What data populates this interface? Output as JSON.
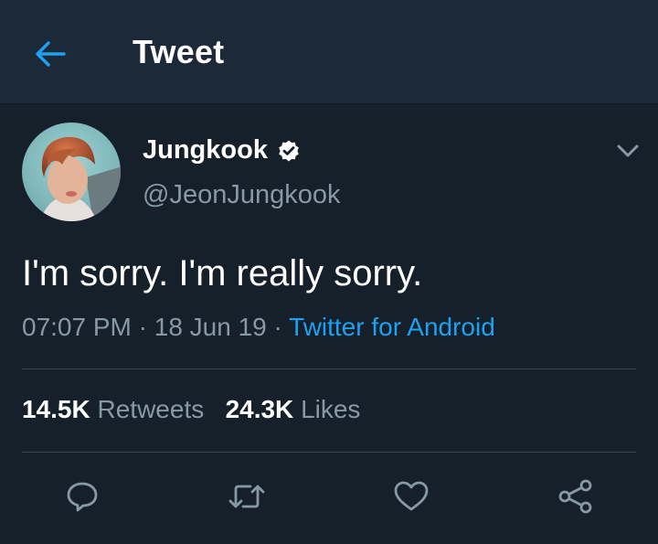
{
  "header": {
    "title": "Tweet",
    "back_icon": "arrow-left-icon"
  },
  "tweet": {
    "display_name": "Jungkook",
    "verified_icon": "verified-badge-icon",
    "handle": "@JeonJungkook",
    "text": "I'm sorry. I'm really sorry.",
    "time": "07:07 PM",
    "date": "18 Jun 19",
    "separator": "·",
    "source": "Twitter for Android"
  },
  "stats": {
    "retweets_count": "14.5K",
    "retweets_label": "Retweets",
    "likes_count": "24.3K",
    "likes_label": "Likes"
  },
  "actions": [
    "reply-icon",
    "retweet-icon",
    "like-icon",
    "share-icon"
  ],
  "colors": {
    "background": "#15202b",
    "header_background": "#1c2938",
    "accent": "#1da1f2",
    "secondary_text": "#8899a6",
    "divider": "#38444d"
  }
}
